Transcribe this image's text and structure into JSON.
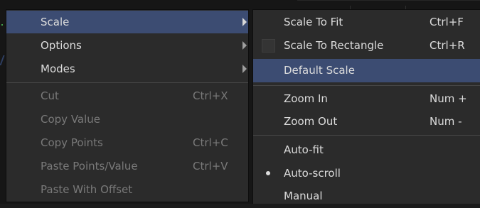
{
  "main_menu": {
    "items": [
      {
        "label": "Scale",
        "shortcut": "",
        "submenu": true,
        "state": "highlighted"
      },
      {
        "label": "Options",
        "shortcut": "",
        "submenu": true,
        "state": "normal"
      },
      {
        "label": "Modes",
        "shortcut": "",
        "submenu": true,
        "state": "normal"
      },
      {
        "label": "Cut",
        "shortcut": "Ctrl+X",
        "submenu": false,
        "state": "disabled"
      },
      {
        "label": "Copy Value",
        "shortcut": "",
        "submenu": false,
        "state": "disabled"
      },
      {
        "label": "Copy Points",
        "shortcut": "Ctrl+C",
        "submenu": false,
        "state": "disabled"
      },
      {
        "label": "Paste Points/Value",
        "shortcut": "Ctrl+V",
        "submenu": false,
        "state": "disabled"
      },
      {
        "label": "Paste With Offset",
        "shortcut": "",
        "submenu": false,
        "state": "disabled"
      }
    ]
  },
  "scale_submenu": {
    "items": [
      {
        "label": "Scale To Fit",
        "shortcut": "Ctrl+F",
        "indicator": "none"
      },
      {
        "label": "Scale To Rectangle",
        "shortcut": "Ctrl+R",
        "indicator": "checkbox"
      },
      {
        "label": "Default Scale",
        "shortcut": "",
        "indicator": "none",
        "state": "highlighted"
      },
      {
        "label": "Zoom In",
        "shortcut": "Num +",
        "indicator": "none"
      },
      {
        "label": "Zoom Out",
        "shortcut": "Num -",
        "indicator": "none"
      },
      {
        "label": "Auto-fit",
        "shortcut": "",
        "indicator": "none"
      },
      {
        "label": "Auto-scroll",
        "shortcut": "",
        "indicator": "radio-selected"
      },
      {
        "label": "Manual",
        "shortcut": "",
        "indicator": "none"
      }
    ]
  },
  "colors": {
    "menu_bg": "#2b2b2b",
    "highlight": "#3c4c72",
    "text": "#dcdcdc",
    "disabled_text": "#797979"
  }
}
